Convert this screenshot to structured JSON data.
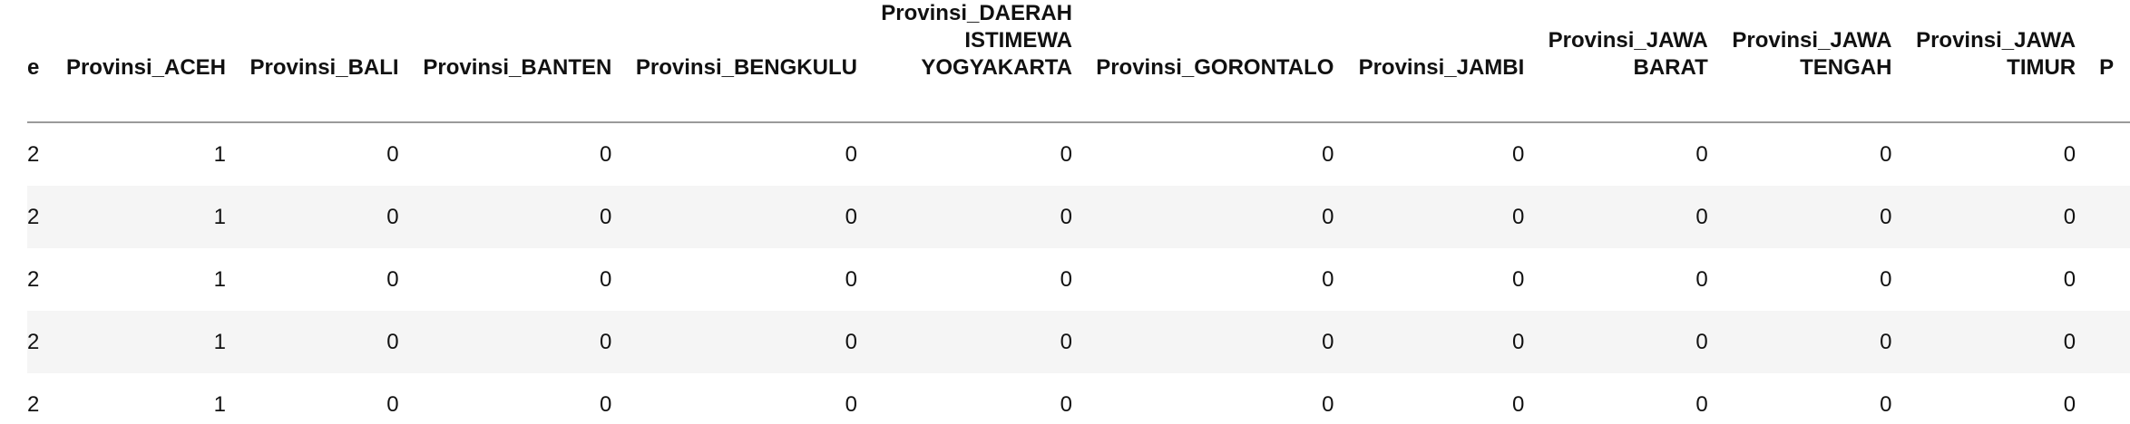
{
  "table": {
    "columns": [
      "e",
      "Provinsi_ACEH",
      "Provinsi_BALI",
      "Provinsi_BANTEN",
      "Provinsi_BENGKULU",
      "Provinsi_DAERAH ISTIMEWA YOGYAKARTA",
      "Provinsi_GORONTALO",
      "Provinsi_JAMBI",
      "Provinsi_JAWA BARAT",
      "Provinsi_JAWA TENGAH",
      "Provinsi_JAWA TIMUR",
      "P"
    ],
    "rows": [
      [
        "2",
        "1",
        "0",
        "0",
        "0",
        "0",
        "0",
        "0",
        "0",
        "0",
        "0",
        ""
      ],
      [
        "2",
        "1",
        "0",
        "0",
        "0",
        "0",
        "0",
        "0",
        "0",
        "0",
        "0",
        ""
      ],
      [
        "2",
        "1",
        "0",
        "0",
        "0",
        "0",
        "0",
        "0",
        "0",
        "0",
        "0",
        ""
      ],
      [
        "2",
        "1",
        "0",
        "0",
        "0",
        "0",
        "0",
        "0",
        "0",
        "0",
        "0",
        ""
      ],
      [
        "2",
        "1",
        "0",
        "0",
        "0",
        "0",
        "0",
        "0",
        "0",
        "0",
        "0",
        ""
      ]
    ]
  }
}
